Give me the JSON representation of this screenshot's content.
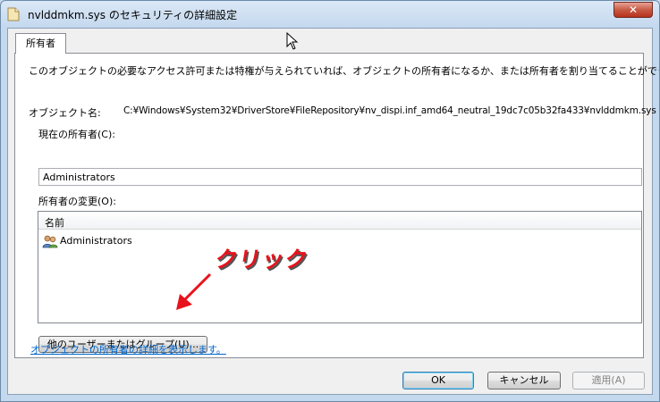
{
  "window": {
    "title": "nvlddmkm.sys のセキュリティの詳細設定",
    "close_icon": "close-icon"
  },
  "tabs": [
    {
      "label": "所有者"
    }
  ],
  "owner_tab": {
    "description": "このオブジェクトの必要なアクセス許可または特権が与えられていれば、オブジェクトの所有者になるか、または所有者を割り当てることができます。",
    "object_name_label": "オブジェクト名:",
    "object_name_value": "C:¥Windows¥System32¥DriverStore¥FileRepository¥nv_dispi.inf_amd64_neutral_19dc7c05b32fa433¥nvlddmkm.sys",
    "current_owner_label": "現在の所有者(C):",
    "current_owner_value": "Administrators",
    "change_owner_label": "所有者の変更(O):",
    "list": {
      "column_header": "名前",
      "items": [
        {
          "label": "Administrators",
          "icon": "user-group-icon"
        }
      ]
    },
    "other_users_button": "他のユーザーまたはグループ(U)...",
    "details_link": "オブジェクトの所有者の詳細を表示します。"
  },
  "annotation": {
    "text": "クリック",
    "color": "#e8121b"
  },
  "footer": {
    "ok": "OK",
    "cancel": "キャンセル",
    "apply": "適用(A)"
  }
}
